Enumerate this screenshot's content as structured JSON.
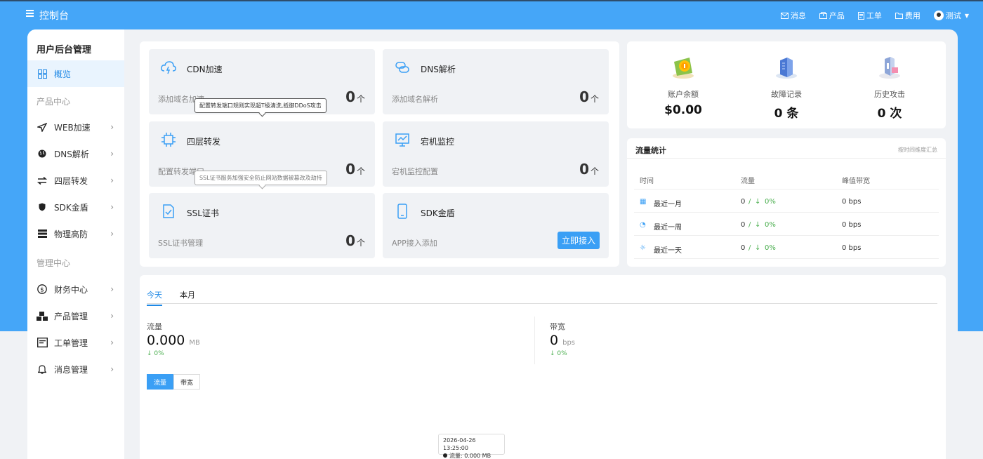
{
  "header": {
    "title": "控制台",
    "nav": [
      {
        "label": "消息",
        "icon": "mail-icon"
      },
      {
        "label": "产品",
        "icon": "box-icon"
      },
      {
        "label": "工单",
        "icon": "ticket-icon"
      },
      {
        "label": "费用",
        "icon": "folder-icon"
      }
    ],
    "user": "测试"
  },
  "sidebar": {
    "title": "用户后台管理",
    "overview": "概览",
    "section_product": "产品中心",
    "product_items": [
      {
        "label": "WEB加速",
        "icon": "paper-plane-icon"
      },
      {
        "label": "DNS解析",
        "icon": "globe-icon"
      },
      {
        "label": "四层转发",
        "icon": "transfer-icon"
      },
      {
        "label": "SDK金盾",
        "icon": "shield-icon"
      },
      {
        "label": "物理高防",
        "icon": "server-icon"
      }
    ],
    "section_manage": "管理中心",
    "manage_items": [
      {
        "label": "财务中心",
        "icon": "dollar-icon"
      },
      {
        "label": "产品管理",
        "icon": "cubes-icon"
      },
      {
        "label": "工单管理",
        "icon": "ticket-icon"
      },
      {
        "label": "消息管理",
        "icon": "bell-icon"
      }
    ]
  },
  "services": [
    {
      "name": "CDN加速",
      "desc": "添加域名加速",
      "count": "0",
      "unit": "个",
      "icon": "cloud-bolt-icon"
    },
    {
      "name": "DNS解析",
      "desc": "添加域名解析",
      "count": "0",
      "unit": "个",
      "icon": "link-icon"
    },
    {
      "name": "四层转发",
      "desc": "配置转发端口",
      "count": "0",
      "unit": "个",
      "icon": "chip-icon"
    },
    {
      "name": "宕机监控",
      "desc": "宕机监控配置",
      "count": "0",
      "unit": "个",
      "icon": "monitor-chart-icon"
    },
    {
      "name": "SSL证书",
      "desc": "SSL证书管理",
      "count": "0",
      "unit": "个",
      "icon": "certificate-icon"
    },
    {
      "name": "SDK金盾",
      "desc": "APP接入添加",
      "button": "立即接入",
      "icon": "phone-icon"
    }
  ],
  "tooltips": {
    "forward": "配置转发端口规则实现超T级清洗,抵御DDoS攻击",
    "ssl": "SSL证书服务加强安全防止网站数据被篡改及劫持"
  },
  "stats": [
    {
      "label": "账户余额",
      "value": "$0.00",
      "icon": "wallet-coin-icon"
    },
    {
      "label": "故障记录",
      "value": "0 条",
      "icon": "building-icon"
    },
    {
      "label": "历史攻击",
      "value": "0 次",
      "icon": "building-chart-icon"
    }
  ],
  "traffic": {
    "title": "流量统计",
    "subtitle": "按时间维度汇总",
    "columns": [
      "时间",
      "流量",
      "峰值带宽"
    ],
    "rows": [
      {
        "period": "最近一月",
        "value": "0",
        "sep": "/",
        "arrow": "↓",
        "pct": "0%",
        "bandwidth": "0 bps",
        "icon": "calendar-icon"
      },
      {
        "period": "最近一周",
        "value": "0",
        "sep": "/",
        "arrow": "↓",
        "pct": "0%",
        "bandwidth": "0 bps",
        "icon": "stopwatch-icon"
      },
      {
        "period": "最近一天",
        "value": "0",
        "sep": "/",
        "arrow": "↓",
        "pct": "0%",
        "bandwidth": "0 bps",
        "icon": "day-icon"
      }
    ]
  },
  "usage": {
    "tabs": [
      "今天",
      "本月"
    ],
    "traffic_label": "流量",
    "traffic_value": "0.000",
    "traffic_unit": "MB",
    "traffic_change": "↓ 0%",
    "bandwidth_label": "带宽",
    "bandwidth_value": "0",
    "bandwidth_unit": "bps",
    "bandwidth_change": "↓ 0%",
    "toggle": [
      "流量",
      "带宽"
    ],
    "chart_tooltip_time": "2026-04-26 13:25:00",
    "chart_tooltip_value": "流量: 0.000 MB"
  },
  "colors": {
    "brand": "#45a6f8",
    "accent": "#1e88e5",
    "success": "#4caf50"
  }
}
